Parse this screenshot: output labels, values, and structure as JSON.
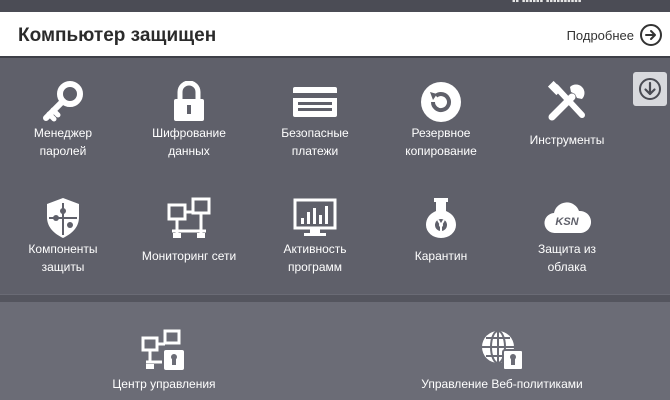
{
  "status": {
    "title": "Компьютер защищен",
    "details_label": "Подробнее"
  },
  "tiles": [
    {
      "label": "Менеджер\nпаролей",
      "icon": "key-icon"
    },
    {
      "label": "Шифрование\nданных",
      "icon": "lock-icon"
    },
    {
      "label": "Безопасные\nплатежи",
      "icon": "card-icon"
    },
    {
      "label": "Резервное\nкопирование",
      "icon": "backup-icon"
    },
    {
      "label": "Инструменты",
      "icon": "tools-icon"
    },
    {
      "label": "Компоненты\nзащиты",
      "icon": "shield-puzzle-icon"
    },
    {
      "label": "Мониторинг сети",
      "icon": "network-icon"
    },
    {
      "label": "Активность\nпрограмм",
      "icon": "monitor-chart-icon"
    },
    {
      "label": "Карантин",
      "icon": "flask-icon"
    },
    {
      "label": "Защита из\nоблака",
      "icon": "ksn-cloud-icon"
    }
  ],
  "bottom": [
    {
      "label": "Центр управления",
      "icon": "control-center-icon"
    },
    {
      "label": "Управление Веб-политиками",
      "icon": "web-policy-icon"
    }
  ],
  "cloud_badge": "KSN",
  "colors": {
    "panel": "#5f606a",
    "bottom_panel": "#6b6c76",
    "status_bg": "#ffffff"
  }
}
